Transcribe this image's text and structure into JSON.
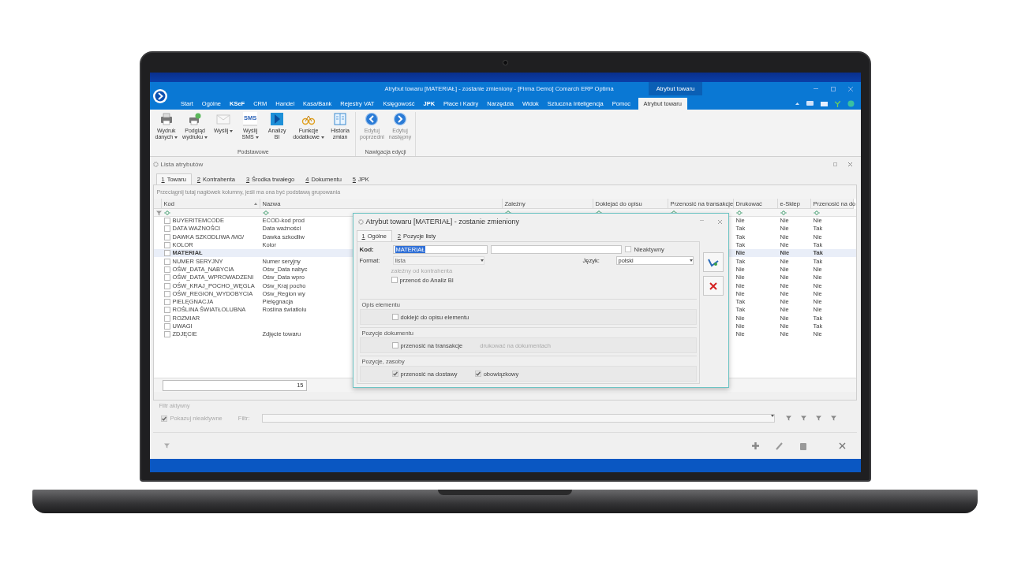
{
  "window": {
    "title": "Atrybut towaru [MATERIAŁ] - zostanie zmieniony - [Firma Demo] Comarch ERP Optima",
    "context_tab": "Atrybut towaru"
  },
  "ribbon": {
    "tabs": [
      {
        "label": "Start",
        "bold": false,
        "selected": false
      },
      {
        "label": "Ogólne",
        "bold": false,
        "selected": false
      },
      {
        "label": "KSeF",
        "bold": true,
        "selected": false
      },
      {
        "label": "CRM",
        "bold": false,
        "selected": false
      },
      {
        "label": "Handel",
        "bold": false,
        "selected": false
      },
      {
        "label": "Kasa/Bank",
        "bold": false,
        "selected": false
      },
      {
        "label": "Rejestry VAT",
        "bold": false,
        "selected": false
      },
      {
        "label": "Księgowość",
        "bold": false,
        "selected": false
      },
      {
        "label": "JPK",
        "bold": true,
        "selected": false
      },
      {
        "label": "Płace i Kadry",
        "bold": false,
        "selected": false
      },
      {
        "label": "Narzędzia",
        "bold": false,
        "selected": false
      },
      {
        "label": "Widok",
        "bold": false,
        "selected": false
      },
      {
        "label": "Sztuczna Inteligencja",
        "bold": false,
        "selected": false
      },
      {
        "label": "Pomoc",
        "bold": false,
        "selected": false
      },
      {
        "label": "Atrybut towaru",
        "bold": false,
        "selected": true
      }
    ],
    "groups": [
      {
        "title": "Podstawowe",
        "buttons": [
          {
            "kind": "printer",
            "lines": [
              "Wydruk",
              "danych"
            ],
            "dropdown": true,
            "disabled": false
          },
          {
            "kind": "preview",
            "lines": [
              "Podgląd",
              "wydruku"
            ],
            "dropdown": true,
            "disabled": false
          },
          {
            "kind": "send",
            "lines": [
              "Wyślij"
            ],
            "dropdown": true,
            "disabled": false
          },
          {
            "kind": "sms",
            "icon_text": "SMS",
            "lines": [
              "Wyślij",
              "SMS"
            ],
            "dropdown": true,
            "disabled": false
          },
          {
            "kind": "bi",
            "lines": [
              "Analizy",
              "BI"
            ],
            "dropdown": false,
            "disabled": false
          },
          {
            "kind": "functions",
            "lines": [
              "Funkcje",
              "dodatkowe"
            ],
            "dropdown": true,
            "disabled": false
          },
          {
            "kind": "history",
            "lines": [
              "Historia",
              "zmian"
            ],
            "dropdown": false,
            "disabled": false
          }
        ]
      },
      {
        "title": "Nawigacja edycji",
        "buttons": [
          {
            "kind": "prev",
            "lines": [
              "Edytuj",
              "poprzedni"
            ],
            "dropdown": false,
            "disabled": true
          },
          {
            "kind": "next",
            "lines": [
              "Edytuj",
              "następny"
            ],
            "dropdown": false,
            "disabled": true
          }
        ]
      }
    ]
  },
  "list_window": {
    "title": "Lista atrybutów",
    "tabs": [
      {
        "key": "1",
        "label": "Towaru",
        "selected": true
      },
      {
        "key": "2",
        "label": "Kontrahenta",
        "selected": false
      },
      {
        "key": "3",
        "label": "Środka trwałego",
        "selected": false
      },
      {
        "key": "4",
        "label": "Dokumentu",
        "selected": false
      },
      {
        "key": "5",
        "label": "JPK",
        "selected": false
      }
    ],
    "group_hint": "Przeciągnij tutaj nagłówek kolumny, jeśli ma ona być podstawą grupowania",
    "table": {
      "columns": [
        "Kod",
        "Nazwa",
        "Zależny",
        "Doklejać do opisu",
        "Przenosić na transakcje",
        "Drukować",
        "e-Sklep",
        "Przenosić na do"
      ],
      "rows": [
        {
          "kod": "BUYERITEMCODE",
          "nazwa": "ECOD-kod prod",
          "drukowac": "Nie",
          "e_sklep": "Nie",
          "przenosic": "Nie",
          "checked": false,
          "selected": false
        },
        {
          "kod": "DATA WAŻNOŚCI",
          "nazwa": "Data ważności",
          "drukowac": "Tak",
          "e_sklep": "Nie",
          "przenosic": "Tak",
          "checked": false,
          "selected": false
        },
        {
          "kod": "DAWKA SZKODLIWA /MG/",
          "nazwa": "Dawka szkodliw",
          "drukowac": "Tak",
          "e_sklep": "Nie",
          "przenosic": "Nie",
          "checked": false,
          "selected": false
        },
        {
          "kod": "KOLOR",
          "nazwa": "Kolor",
          "drukowac": "Tak",
          "e_sklep": "Nie",
          "przenosic": "Tak",
          "checked": false,
          "selected": false
        },
        {
          "kod": "MATERIAŁ",
          "drukowac": "Nie",
          "e_sklep": "Nie",
          "przenosic": "Tak",
          "checked": false,
          "selected": true
        },
        {
          "kod": "NUMER SERYJNY",
          "nazwa": "Numer seryjny",
          "drukowac": "Tak",
          "e_sklep": "Nie",
          "przenosic": "Tak",
          "checked": false,
          "selected": false
        },
        {
          "kod": "OŚW_DATA_NABYCIA",
          "nazwa": "Ośw_Data nabyc",
          "drukowac": "Nie",
          "e_sklep": "Nie",
          "przenosic": "Nie",
          "checked": false,
          "selected": false
        },
        {
          "kod": "OŚW_DATA_WPROWADZENI",
          "nazwa": "Ośw_Data wpro",
          "drukowac": "Nie",
          "e_sklep": "Nie",
          "przenosic": "Nie",
          "checked": false,
          "selected": false
        },
        {
          "kod": "OŚW_KRAJ_POCHO_WĘGLA",
          "nazwa": "Ośw_Kraj pocho",
          "drukowac": "Nie",
          "e_sklep": "Nie",
          "przenosic": "Nie",
          "checked": false,
          "selected": false
        },
        {
          "kod": "OŚW_REGION_WYDOBYCIA",
          "nazwa": "Ośw_Region wy",
          "drukowac": "Nie",
          "e_sklep": "Nie",
          "przenosic": "Nie",
          "checked": false,
          "selected": false
        },
        {
          "kod": "PIELĘGNACJA",
          "nazwa": "Pielęgnacja",
          "drukowac": "Tak",
          "e_sklep": "Nie",
          "przenosic": "Nie",
          "checked": false,
          "selected": false
        },
        {
          "kod": "ROŚLINA ŚWIATŁOLUBNA",
          "nazwa": "Roślina światłolu",
          "drukowac": "Tak",
          "e_sklep": "Nie",
          "przenosic": "Nie",
          "checked": false,
          "selected": false
        },
        {
          "kod": "ROZMIAR",
          "drukowac": "Nie",
          "e_sklep": "Nie",
          "przenosic": "Tak",
          "checked": false,
          "selected": false
        },
        {
          "kod": "UWAGI",
          "drukowac": "Nie",
          "e_sklep": "Nie",
          "przenosic": "Tak",
          "checked": false,
          "selected": false
        },
        {
          "kod": "ZDJĘCIE",
          "nazwa": "Zdjęcie towaru",
          "drukowac": "Nie",
          "e_sklep": "Nie",
          "przenosic": "Nie",
          "checked": false,
          "selected": false
        }
      ],
      "count": "15"
    },
    "filter": {
      "title": "Filtr aktywny",
      "show_inactive": {
        "label": "Pokazuj nieaktywne",
        "checked": true
      },
      "filter_label": "Filtr:"
    }
  },
  "dialog": {
    "title": "Atrybut towaru [MATERIAŁ] - zostanie zmieniony",
    "tabs": [
      {
        "key": "1",
        "label": "Ogólne",
        "selected": true
      },
      {
        "key": "2",
        "label": "Pozycje listy",
        "selected": false
      }
    ],
    "kod_label": "Kod:",
    "kod_value": "MATERIAŁ",
    "inactive": {
      "label": "Nieaktywny",
      "checked": false
    },
    "format_label": "Format:",
    "format_value": "lista",
    "language_label": "Język:",
    "language_value": "polski",
    "options": [
      {
        "label": "zależny od kontrahenta",
        "disabled": true
      },
      {
        "label": "przenoś do Analiz BI",
        "checked": false,
        "disabled": false
      }
    ],
    "sections": [
      {
        "title": "Opis elementu",
        "options": [
          {
            "label": "doklejć do opisu elementu",
            "checked": false,
            "disabled": false
          }
        ]
      },
      {
        "title": "Pozycje dokumentu",
        "options": [
          {
            "label": "przenosić na transakcje",
            "checked": false,
            "disabled": false
          },
          {
            "label": "drukować na dokumentach",
            "disabled": true
          }
        ]
      },
      {
        "title": "Pozycje, zasoby",
        "options": [
          {
            "label": "przenosić na dostawy",
            "checked": true,
            "disabled": false
          },
          {
            "label": "obowiązkowy",
            "checked": true,
            "disabled": false
          }
        ]
      }
    ]
  }
}
